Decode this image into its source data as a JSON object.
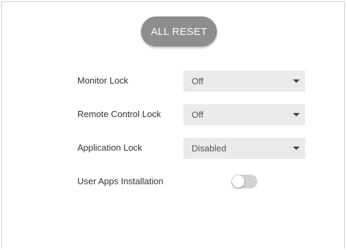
{
  "reset_button": {
    "label": "ALL RESET"
  },
  "settings": [
    {
      "label": "Monitor Lock",
      "value": "Off"
    },
    {
      "label": "Remote Control Lock",
      "value": "Off"
    },
    {
      "label": "Application Lock",
      "value": "Disabled"
    }
  ],
  "user_apps": {
    "label": "User Apps Installation",
    "enabled": false
  },
  "colors": {
    "button_bg": "#8e8e8e",
    "select_bg": "#ebebeb",
    "toggle_off": "#d2d2d2"
  },
  "icons": {
    "dropdown": "caret-down-icon"
  }
}
